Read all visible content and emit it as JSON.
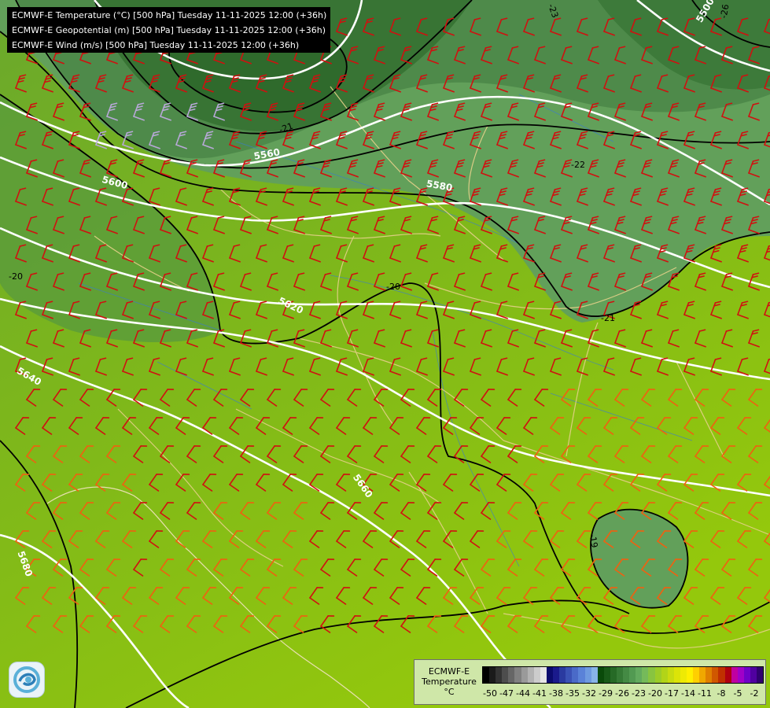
{
  "titles": [
    "ECMWF-E Temperature (°C) [500 hPa] Tuesday 11-11-2025 12:00 (+36h)",
    "ECMWF-E Geopotential (m) [500 hPa] Tuesday 11-11-2025 12:00 (+36h)",
    "ECMWF-E Wind (m/s) [500 hPa] Tuesday 11-11-2025 12:00 (+36h)"
  ],
  "legend": {
    "model": "ECMWF-E",
    "variable": "Temperature",
    "unit": "°C",
    "ticks": [
      "-50",
      "-47",
      "-44",
      "-41",
      "-38",
      "-35",
      "-32",
      "-29",
      "-26",
      "-23",
      "-20",
      "-17",
      "-14",
      "-11",
      "-8",
      "-5",
      "-2"
    ],
    "colors": [
      "#000000",
      "#1a1a1a",
      "#333333",
      "#4d4d4d",
      "#666666",
      "#808080",
      "#9a9a9a",
      "#b3b3b3",
      "#cccccc",
      "#e6e6e6",
      "#0b0b6e",
      "#1a1a8c",
      "#2a3aa0",
      "#3a52b5",
      "#4a6ac8",
      "#5a82d8",
      "#6e9ae0",
      "#88b4e8",
      "#0a4a0a",
      "#185a18",
      "#266a26",
      "#357a35",
      "#448a44",
      "#529a52",
      "#62aa5e",
      "#75ba5a",
      "#88c440",
      "#9ccc28",
      "#b2d418",
      "#c8dc10",
      "#dce408",
      "#eeea04",
      "#fff000",
      "#ffd000",
      "#f0a800",
      "#e08000",
      "#d05800",
      "#c03000",
      "#b00010",
      "#c000a0",
      "#a000c8",
      "#7000c8",
      "#5000a0",
      "#300070"
    ]
  },
  "isohypses": [
    "5500",
    "5560",
    "5580",
    "5600",
    "5620",
    "5640",
    "5660",
    "5680"
  ],
  "isotherms": [
    "-26",
    "-23",
    "-22",
    "-21",
    "-20",
    "-21",
    "-20",
    "-19"
  ],
  "colors": {
    "temp_cold": "#3f7f3f",
    "temp_mid": "#6aa84c",
    "temp_warm": "#86bc12",
    "height_contour": "#ffffff",
    "temp_contour": "#000000",
    "border": "#e6d08a",
    "river": "#3a7ad0",
    "barb_red": "#d01010",
    "barb_orange": "#f06010",
    "barb_lilac": "#b8a8d8"
  }
}
